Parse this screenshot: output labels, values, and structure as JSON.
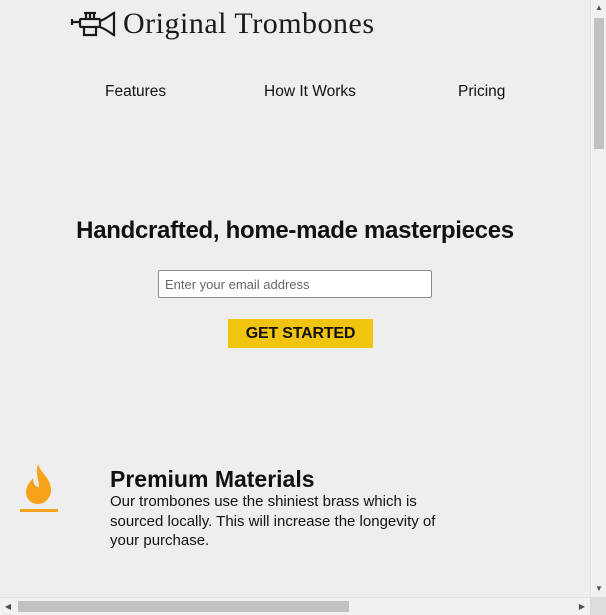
{
  "header": {
    "logo_alt": "trumpet-logo",
    "brand": "Original Trombones"
  },
  "nav": {
    "items": [
      {
        "label": "Features"
      },
      {
        "label": "How It Works"
      },
      {
        "label": "Pricing"
      }
    ]
  },
  "hero": {
    "title": "Handcrafted, home-made masterpieces",
    "email_placeholder": "Enter your email address",
    "email_value": "",
    "cta_label": "GET STARTED"
  },
  "features": [
    {
      "icon": "fire-icon",
      "title": "Premium Materials",
      "description": "Our trombones use the shiniest brass which is sourced locally. This will increase the longevity of your purchase."
    }
  ],
  "colors": {
    "page_background": "#eeeeee",
    "cta_background": "#f1c40f",
    "feature_icon": "#f7a21b"
  },
  "scrollbars": {
    "vertical": {
      "up_arrow": "▲",
      "down_arrow": "▼"
    },
    "horizontal": {
      "left_arrow": "◀",
      "right_arrow": "▶"
    }
  }
}
